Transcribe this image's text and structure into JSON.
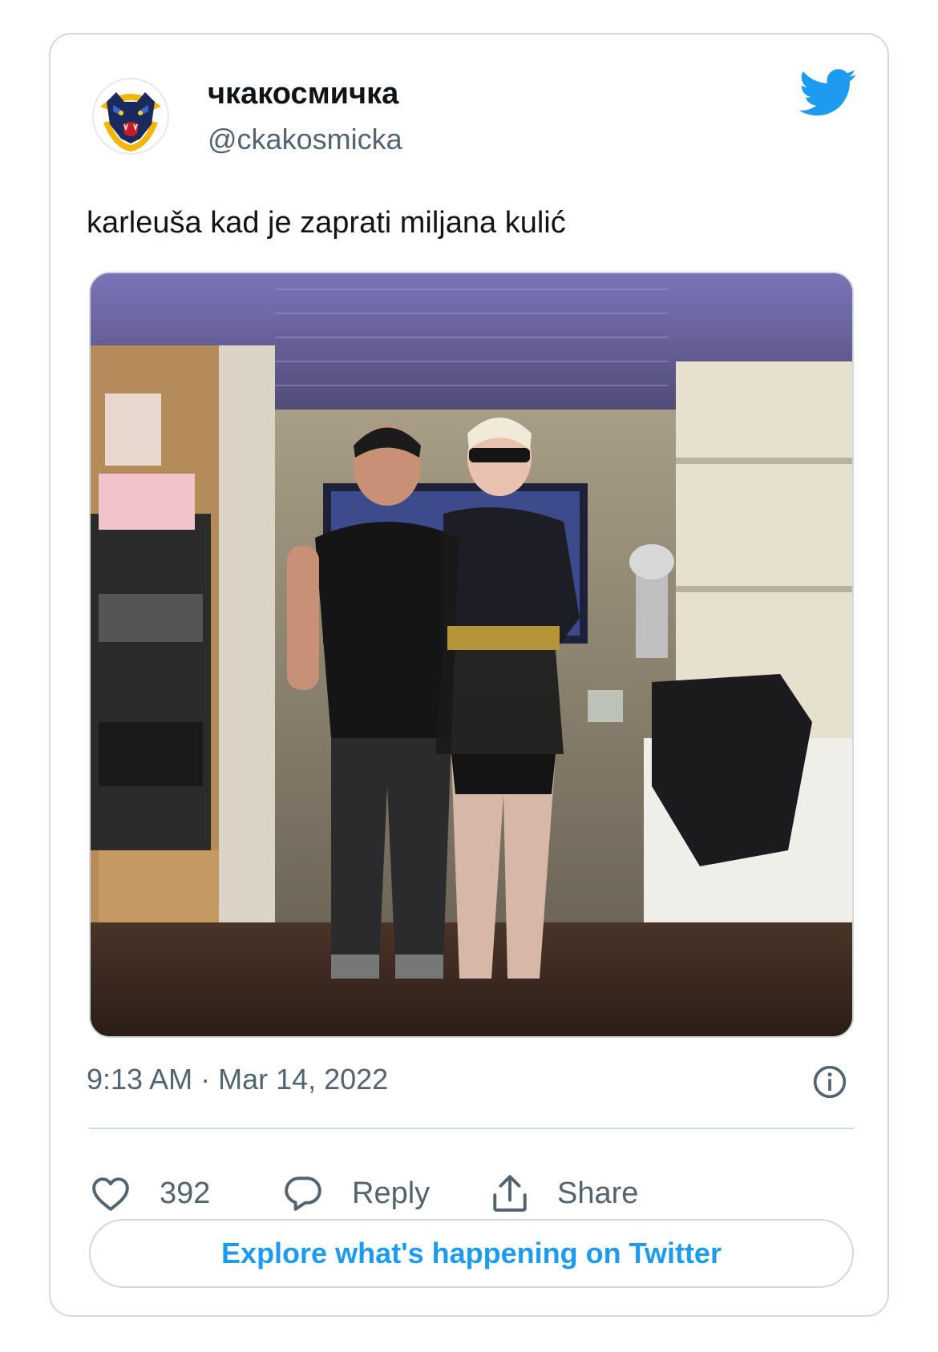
{
  "tweet": {
    "author": {
      "display_name": "чкакосмичка",
      "handle": "@ckakosmicka",
      "avatar_icon": "panther-logo-avatar"
    },
    "text": "karleuša kad je zaprati miljana kulić",
    "media": {
      "type": "photo",
      "description_icon": "photo-image"
    },
    "timestamp": "9:13 AM · Mar 14, 2022",
    "actions": {
      "likes_count": "392",
      "reply_label": "Reply",
      "share_label": "Share"
    },
    "explore_label": "Explore what's happening on Twitter"
  },
  "colors": {
    "brand_blue": "#1d9bf0",
    "secondary_text": "#536471",
    "border": "#cfd9de"
  }
}
